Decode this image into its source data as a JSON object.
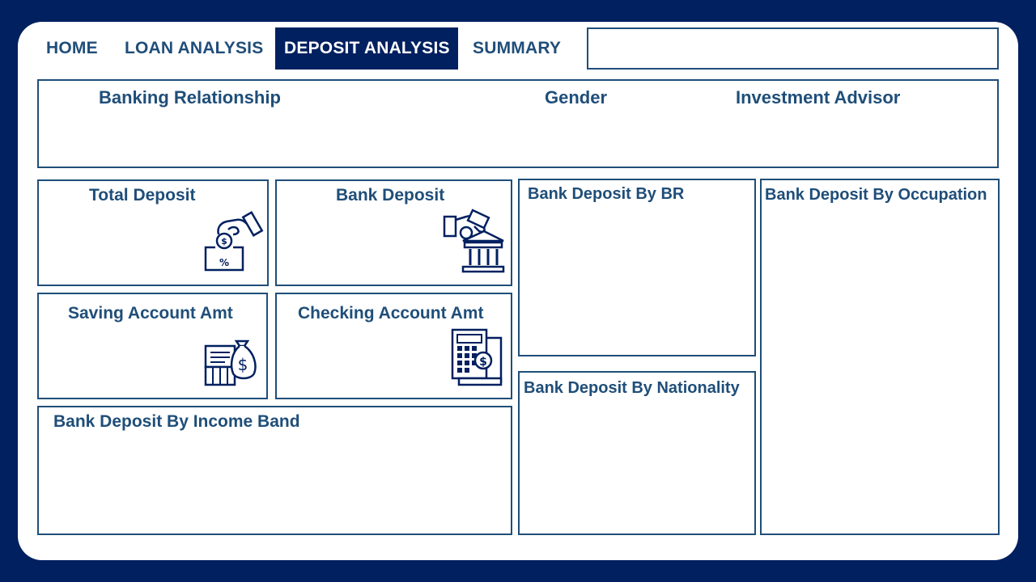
{
  "nav": {
    "tabs": [
      {
        "label": "HOME"
      },
      {
        "label": "LOAN ANALYSIS"
      },
      {
        "label": "DEPOSIT ANALYSIS",
        "active": true
      },
      {
        "label": "SUMMARY"
      }
    ]
  },
  "search": {
    "value": ""
  },
  "filters": {
    "banking_relationship": "Banking Relationship",
    "gender": "Gender",
    "investment_advisor": "Investment Advisor"
  },
  "kpis": {
    "total_deposit": {
      "title": "Total Deposit",
      "icon": "hand-coin-percent-box-icon"
    },
    "bank_deposit": {
      "title": "Bank Deposit",
      "icon": "hand-money-bank-icon"
    },
    "saving_account_amt": {
      "title": "Saving Account Amt",
      "icon": "cash-register-money-bag-icon"
    },
    "checking_account_amt": {
      "title": "Checking Account Amt",
      "icon": "calculator-invoice-dollar-icon"
    }
  },
  "charts": {
    "by_income_band": "Bank Deposit By Income Band",
    "by_br": "Bank Deposit By BR",
    "by_nationality": "Bank Deposit By Nationality",
    "by_occupation": "Bank Deposit By Occupation"
  },
  "colors": {
    "background": "#012060",
    "accent": "#1f4e79",
    "surface": "#ffffff"
  }
}
